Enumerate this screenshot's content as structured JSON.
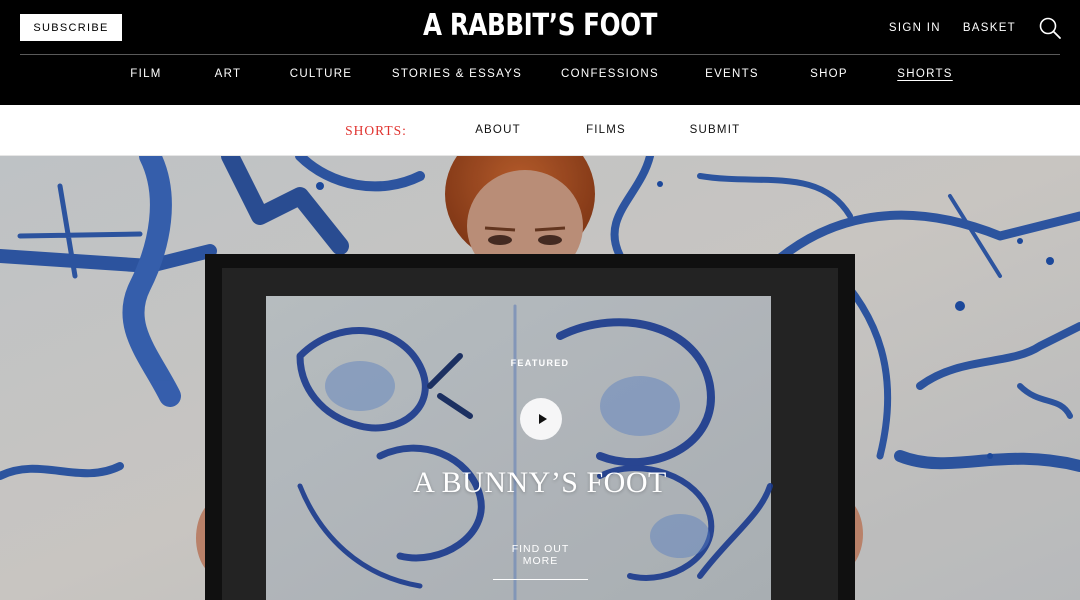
{
  "header": {
    "subscribe_label": "SUBSCRIBE",
    "logo": "A RABBIT’S FOOT",
    "sign_in_label": "SIGN IN",
    "basket_label": "BASKET",
    "search_icon": "search-icon"
  },
  "main_nav": {
    "items": [
      {
        "label": "FILM"
      },
      {
        "label": "ART"
      },
      {
        "label": "CULTURE"
      },
      {
        "label": "STORIES & ESSAYS"
      },
      {
        "label": "CONFESSIONS"
      },
      {
        "label": "EVENTS"
      },
      {
        "label": "SHOP"
      },
      {
        "label": "SHORTS",
        "active": true
      }
    ]
  },
  "sub_nav": {
    "section_label": "SHORTS:",
    "items": [
      {
        "label": "ABOUT"
      },
      {
        "label": "FILMS"
      },
      {
        "label": "SUBMIT"
      }
    ]
  },
  "hero": {
    "kicker": "FEATURED",
    "title": "A BUNNY’S FOOT",
    "cta_label": "FIND OUT MORE",
    "play_icon": "play-icon"
  },
  "colors": {
    "header_bg": "#000000",
    "subnav_bg": "#ffffff",
    "accent_red": "#e0322e",
    "ink_blue": "#1f4fa8"
  }
}
